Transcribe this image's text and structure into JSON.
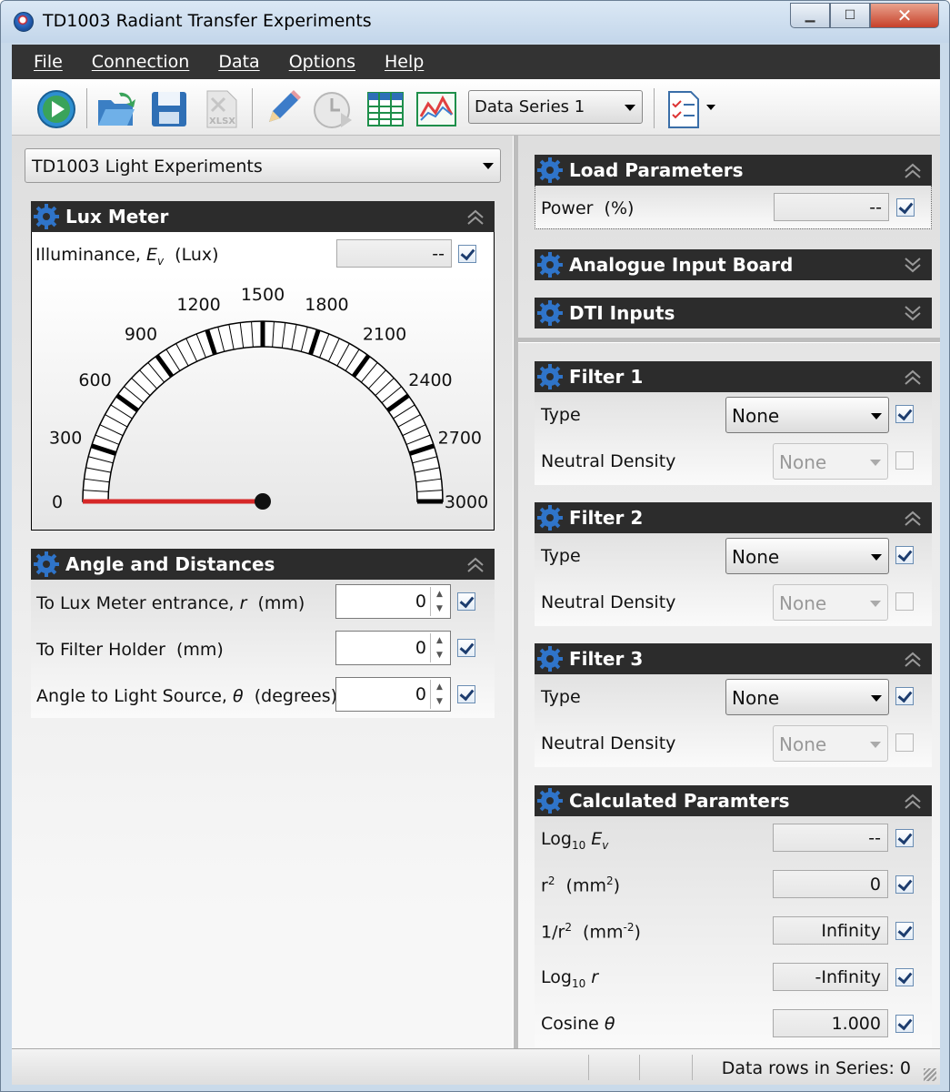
{
  "window": {
    "title": "TD1003 Radiant Transfer Experiments",
    "min_glyph": "▁",
    "max_glyph": "☐",
    "close_glyph": "✕"
  },
  "menu": [
    "File",
    "Connection",
    "Data",
    "Options",
    "Help"
  ],
  "toolbar": {
    "icons": [
      "play-icon",
      "open-icon",
      "save-icon",
      "xlsx-export-icon",
      "pencil-icon",
      "clock-icon",
      "table-icon",
      "chart-icon",
      "report-icon"
    ],
    "xlsx_label": "XLSX",
    "series_select": "Data Series 1",
    "colors": {
      "play": "#2d8fd0",
      "accent_green": "#3aa35a"
    }
  },
  "experiment_select": "TD1003 Light Experiments",
  "lux_meter": {
    "header": "Lux Meter",
    "label_main": "Illuminance, ",
    "label_sym": "E",
    "label_sub": "v",
    "label_unit": "(Lux)",
    "value": "--",
    "gauge": {
      "ticks": [
        "0",
        "300",
        "600",
        "900",
        "1200",
        "1500",
        "1800",
        "2100",
        "2400",
        "2700",
        "3000"
      ],
      "min": 0,
      "max": 3000,
      "reading": 0,
      "needle_color": "#d62828"
    }
  },
  "angle_distances": {
    "header": "Angle and Distances",
    "rows": [
      {
        "label": "To Lux Meter entrance, ",
        "sym": "r",
        "unit": "(mm)",
        "value": "0"
      },
      {
        "label": "To Filter Holder",
        "sym": "",
        "unit": "(mm)",
        "value": "0"
      },
      {
        "label": "Angle to Light Source, ",
        "sym": "θ",
        "unit": "(degrees)",
        "value": "0"
      }
    ]
  },
  "load_parameters": {
    "header": "Load Parameters",
    "label": "Power",
    "unit": "(%)",
    "value": "--"
  },
  "analogue_input": {
    "header": "Analogue Input Board"
  },
  "dti_inputs": {
    "header": "DTI Inputs"
  },
  "filters": [
    {
      "header": "Filter 1",
      "type_label": "Type",
      "type_value": "None",
      "nd_label": "Neutral Density",
      "nd_value": "None"
    },
    {
      "header": "Filter 2",
      "type_label": "Type",
      "type_value": "None",
      "nd_label": "Neutral Density",
      "nd_value": "None"
    },
    {
      "header": "Filter 3",
      "type_label": "Type",
      "type_value": "None",
      "nd_label": "Neutral Density",
      "nd_value": "None"
    }
  ],
  "calculated": {
    "header": "Calculated Paramters",
    "rows": [
      {
        "a": "Log",
        "sub": "10",
        "b": " E",
        "sub2": "v",
        "sup": "",
        "unit": "",
        "unit_sup": "",
        "unit_end": "",
        "value": "--"
      },
      {
        "a": "r",
        "sub": "",
        "b": "",
        "sub2": "",
        "sup": "2",
        "unit": "(mm",
        "unit_sup": "2",
        "unit_end": ")",
        "value": "0"
      },
      {
        "a": "1/r",
        "sub": "",
        "b": "",
        "sub2": "",
        "sup": "2",
        "unit": "(mm",
        "unit_sup": "-2",
        "unit_end": ")",
        "value": "Infinity"
      },
      {
        "a": "Log",
        "sub": "10",
        "b": " r",
        "sub2": "",
        "sup": "",
        "unit": "",
        "unit_sup": "",
        "unit_end": "",
        "value": "-Infinity"
      },
      {
        "a": "Cosine ",
        "sub": "",
        "b": "θ",
        "sub2": "",
        "sup": "",
        "unit": "",
        "unit_sup": "",
        "unit_end": "",
        "value": "1.000"
      }
    ]
  },
  "status": {
    "text": "Data rows in Series: 0"
  }
}
